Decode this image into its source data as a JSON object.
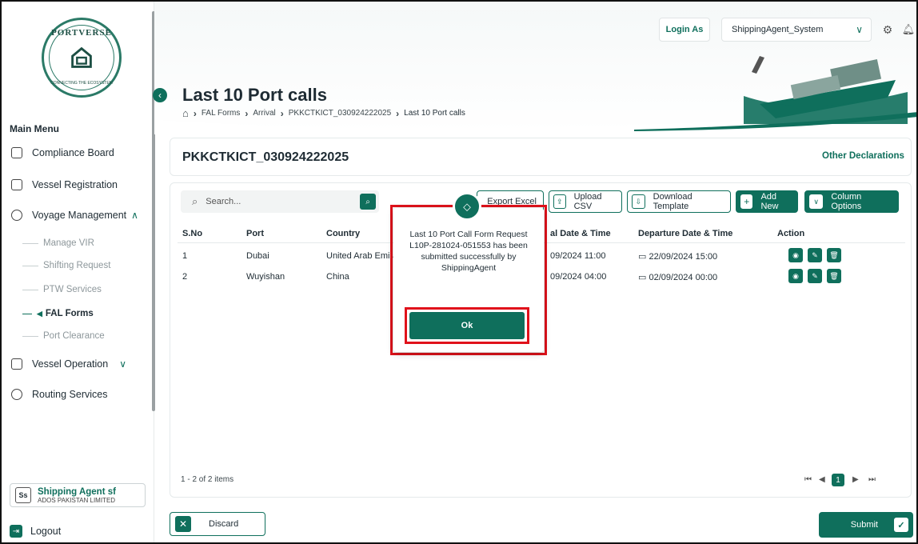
{
  "sidebar": {
    "logo_text": "PORTVERSE",
    "logo_tagline": "CONNECTING THE ECOSYSTEM",
    "main_menu_label": "Main Menu",
    "items": [
      {
        "label": "Compliance Board",
        "icon": "clipboard-icon"
      },
      {
        "label": "Vessel Registration",
        "icon": "ship-icon"
      },
      {
        "label": "Voyage Management",
        "icon": "compass-icon"
      },
      {
        "label": "Vessel Operation",
        "icon": "anchor-icon"
      },
      {
        "label": "Routing Services",
        "icon": "route-icon"
      }
    ],
    "sub_items": [
      "Manage VIR",
      "Shifting Request",
      "PTW Services",
      "FAL Forms",
      "Port Clearance"
    ],
    "active_sub_item": "FAL Forms",
    "user": {
      "initials": "Ss",
      "name": "Shipping Agent sf",
      "org": "ADOS PAKISTAN LIMITED"
    },
    "logout_label": "Logout"
  },
  "header": {
    "login_as_label": "Login As",
    "login_as_value": "ShippingAgent_System",
    "page_title": "Last 10 Port calls",
    "breadcrumb": [
      "FAL Forms",
      "Arrival",
      "PKKCTKICT_030924222025",
      "Last 10 Port calls"
    ]
  },
  "content": {
    "record_title": "PKKCTKICT_030924222025",
    "other_declarations": "Other Declarations",
    "search_placeholder": "Search...",
    "toolbar": {
      "export_excel": "Export Excel",
      "upload_csv": "Upload CSV",
      "download_template": "Download Template",
      "add_new": "Add New",
      "column_options": "Column Options"
    },
    "table": {
      "columns": [
        "S.No",
        "Port",
        "Country",
        "al Date & Time",
        "Departure Date & Time",
        "Action"
      ],
      "rows": [
        {
          "sno": "1",
          "port": "Dubai",
          "country": "United Arab Emira",
          "arrival": "09/2024 11:00",
          "departure": "22/09/2024 15:00"
        },
        {
          "sno": "2",
          "port": "Wuyishan",
          "country": "China",
          "arrival": "09/2024 04:00",
          "departure": "02/09/2024 00:00"
        }
      ]
    },
    "pager_info": "1 - 2 of 2 items",
    "current_page": "1",
    "discard_label": "Discard",
    "submit_label": "Submit"
  },
  "modal": {
    "message": "Last 10 Port Call Form Request L10P-281024-051553 has been submitted successfully by ShippingAgent",
    "ok_label": "Ok"
  },
  "colors": {
    "primary": "#0f6f5c",
    "highlight": "#e0121b"
  }
}
